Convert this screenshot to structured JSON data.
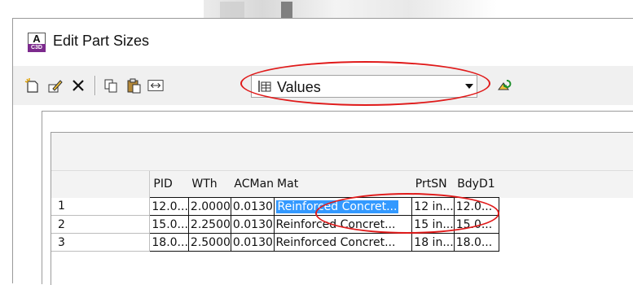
{
  "window": {
    "title": "Edit Part Sizes",
    "app_icon_letter": "A",
    "app_icon_sub": "C3D"
  },
  "toolbar": {
    "buttons": [
      {
        "name": "new-row-icon"
      },
      {
        "name": "edit-icon"
      },
      {
        "name": "delete-icon"
      },
      {
        "name": "copy-icon"
      },
      {
        "name": "paste-icon"
      },
      {
        "name": "insert-column-icon"
      },
      {
        "name": "refresh-icon"
      }
    ],
    "view_dropdown": {
      "selected": "Values"
    }
  },
  "table": {
    "columns": [
      "PID",
      "WTh",
      "ACMan",
      "Mat",
      "PrtSN",
      "BdyD1"
    ],
    "rows": [
      {
        "id": "1",
        "cells": [
          "12.0...",
          "2.0000",
          "0.0130",
          "Reinforced Concret...",
          "12 in...",
          "12.0..."
        ]
      },
      {
        "id": "2",
        "cells": [
          "15.0...",
          "2.2500",
          "0.0130",
          "Reinforced Concret...",
          "15 in...",
          "15.0..."
        ]
      },
      {
        "id": "3",
        "cells": [
          "18.0...",
          "2.5000",
          "0.0130",
          "Reinforced Concret...",
          "18 in...",
          "18.0..."
        ]
      }
    ],
    "selected_cell": {
      "row": 0,
      "column": "Mat"
    }
  },
  "colors": {
    "highlight_ring": "#e01a1a",
    "selection": "#3399ff",
    "toolbar_bg": "#f0f0f0"
  }
}
